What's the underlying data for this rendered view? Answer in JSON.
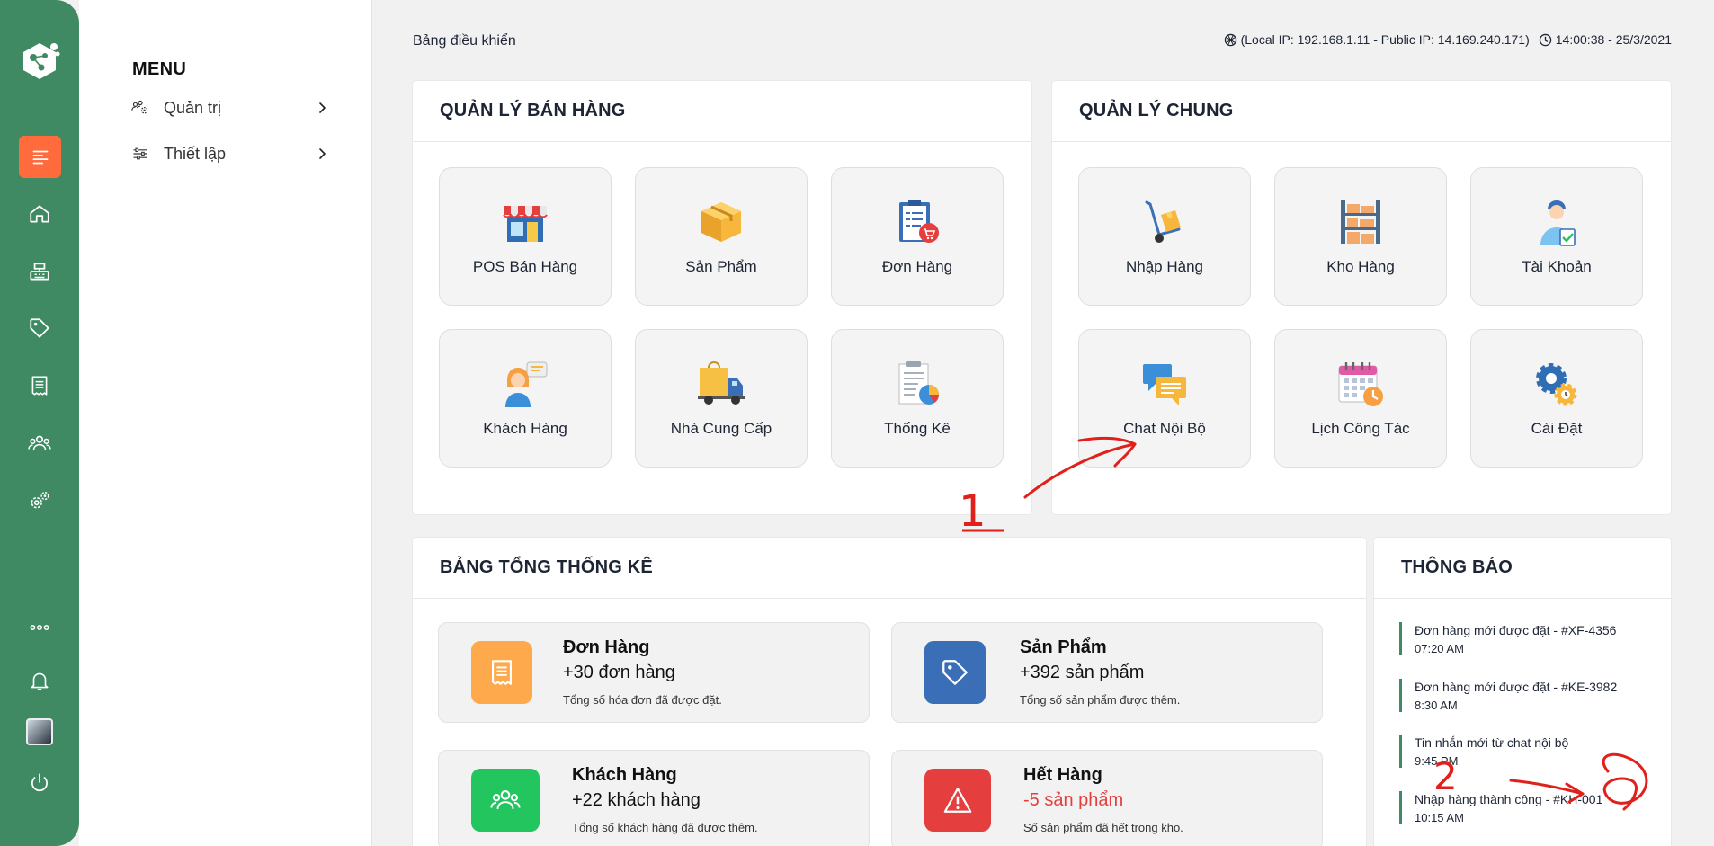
{
  "sidebar_rail": {
    "items": [
      {
        "name": "menu-toggle",
        "icon": "menu-lines-icon",
        "active": true
      },
      {
        "name": "home",
        "icon": "home-icon"
      },
      {
        "name": "pos",
        "icon": "cash-register-icon"
      },
      {
        "name": "products",
        "icon": "tag-icon"
      },
      {
        "name": "orders",
        "icon": "receipt-icon"
      },
      {
        "name": "customers",
        "icon": "users-icon"
      },
      {
        "name": "settings",
        "icon": "gears-icon"
      },
      {
        "name": "more",
        "icon": "more-dots-icon"
      },
      {
        "name": "notifications",
        "icon": "bell-icon"
      },
      {
        "name": "user-avatar",
        "icon": "avatar-thumbnail"
      },
      {
        "name": "logout",
        "icon": "power-icon"
      }
    ],
    "accent": "#ff6b3d",
    "background": "#3f8a63"
  },
  "menu": {
    "title": "MENU",
    "items": [
      {
        "label": "Quản trị",
        "icon": "admin-users-gear-icon"
      },
      {
        "label": "Thiết lập",
        "icon": "sliders-icon"
      }
    ]
  },
  "header": {
    "breadcrumb": "Bảng điều khiển",
    "ip_info": "(Local IP: 192.168.1.11 - Public IP: 14.169.240.171)",
    "clock": "14:00:38 - 25/3/2021"
  },
  "sales_management": {
    "title": "QUẢN LÝ BÁN HÀNG",
    "tiles": [
      {
        "label": "POS Bán Hàng",
        "icon": "store-icon"
      },
      {
        "label": "Sản Phẩm",
        "icon": "box-icon"
      },
      {
        "label": "Đơn Hàng",
        "icon": "clipboard-cart-icon"
      },
      {
        "label": "Khách Hàng",
        "icon": "customer-chat-icon"
      },
      {
        "label": "Nhà Cung Cấp",
        "icon": "delivery-truck-icon"
      },
      {
        "label": "Thống Kê",
        "icon": "report-chart-icon"
      }
    ]
  },
  "general_management": {
    "title": "QUẢN LÝ CHUNG",
    "tiles": [
      {
        "label": "Nhập Hàng",
        "icon": "hand-truck-icon"
      },
      {
        "label": "Kho Hàng",
        "icon": "warehouse-shelf-icon"
      },
      {
        "label": "Tài Khoản",
        "icon": "account-user-icon"
      },
      {
        "label": "Chat Nội Bộ",
        "icon": "chat-bubbles-icon"
      },
      {
        "label": "Lịch Công Tác",
        "icon": "calendar-clock-icon"
      },
      {
        "label": "Cài Đặt",
        "icon": "settings-gears-icon"
      }
    ]
  },
  "stats": {
    "title": "BẢNG TỔNG THỐNG KÊ",
    "cards": [
      {
        "title": "Đơn Hàng",
        "value": "+30 đơn hàng",
        "desc": "Tổng số hóa đơn đã được đặt.",
        "color": "#ffa94d",
        "icon": "receipt-icon"
      },
      {
        "title": "Sản Phẩm",
        "value": "+392 sản phẩm",
        "desc": "Tổng số sản phẩm được thêm.",
        "color": "#3a6fb8",
        "icon": "tag-icon"
      },
      {
        "title": "Khách Hàng",
        "value": "+22 khách hàng",
        "desc": "Tổng số khách hàng đã được thêm.",
        "color": "#22c55e",
        "icon": "users-icon"
      },
      {
        "title": "Hết Hàng",
        "value": "-5 sản phẩm",
        "desc": "Số sản phẩm đã hết trong kho.",
        "color": "#e53e3e",
        "icon": "warning-icon",
        "value_color": "#e53e3e"
      }
    ]
  },
  "notifications": {
    "title": "THÔNG BÁO",
    "items": [
      {
        "text": "Đơn hàng mới được đặt - #XF-4356",
        "time": "07:20 AM"
      },
      {
        "text": "Đơn hàng mới được đặt - #KE-3982",
        "time": "8:30 AM"
      },
      {
        "text": "Tin nhắn mới từ chat nội bộ",
        "time": "9:45 PM"
      },
      {
        "text": "Nhập hàng thành công - #KH-001",
        "time": "10:15 AM"
      }
    ]
  },
  "annotations": {
    "color": "#e0201a",
    "labels": [
      "1",
      "2"
    ]
  }
}
